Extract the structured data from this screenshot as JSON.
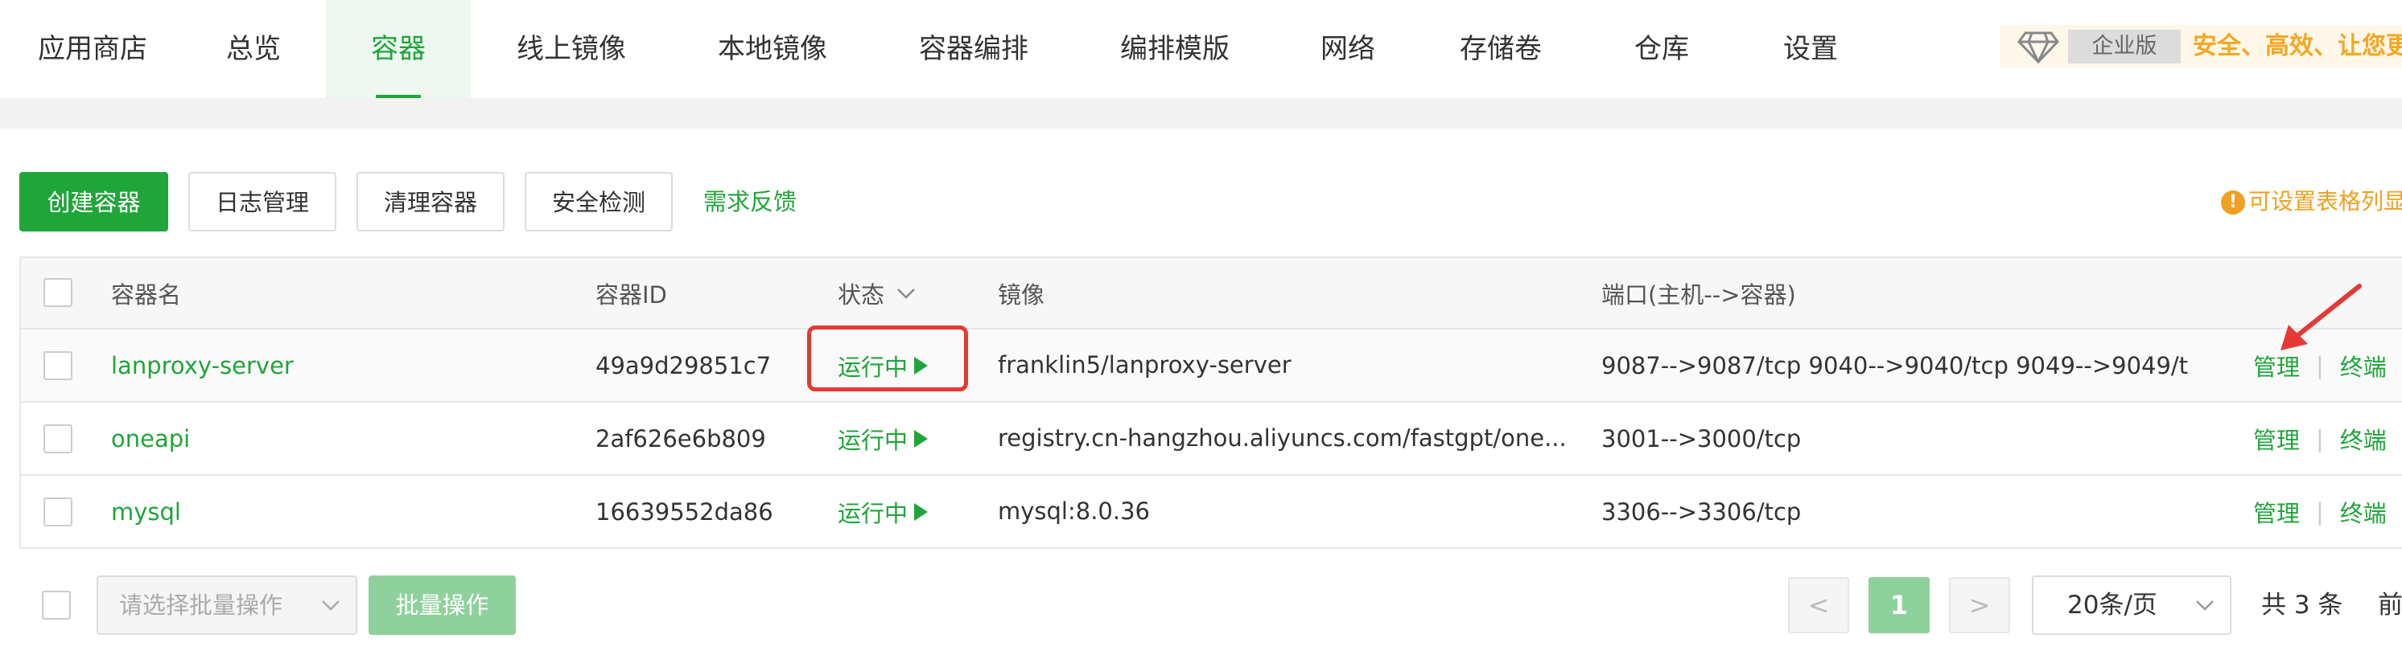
{
  "nav": {
    "tabs": [
      {
        "label": "应用商店"
      },
      {
        "label": "总览"
      },
      {
        "label": "容器",
        "active": true
      },
      {
        "label": "线上镜像"
      },
      {
        "label": "本地镜像"
      },
      {
        "label": "容器编排"
      },
      {
        "label": "编排模版"
      },
      {
        "label": "网络"
      },
      {
        "label": "存储卷"
      },
      {
        "label": "仓库"
      },
      {
        "label": "设置"
      }
    ],
    "promo": {
      "badge": "企业版",
      "text": "安全、高效、让您更安"
    }
  },
  "toolbar": {
    "create": "创建容器",
    "logs": "日志管理",
    "clean": "清理容器",
    "security": "安全检测",
    "feedback": "需求反馈",
    "tip": "可设置表格列显"
  },
  "table": {
    "headers": {
      "name": "容器名",
      "id": "容器ID",
      "status": "状态",
      "image": "镜像",
      "ports": "端口(主机-->容器)"
    },
    "rows": [
      {
        "name": "lanproxy-server",
        "id": "49a9d29851c7",
        "status": "运行中",
        "image": "franklin5/lanproxy-server",
        "ports": "9087-->9087/tcp 9040-->9040/tcp 9049-->9049/t",
        "manage": "管理",
        "terminal": "终端"
      },
      {
        "name": "oneapi",
        "id": "2af626e6b809",
        "status": "运行中",
        "image": "registry.cn-hangzhou.aliyuncs.com/fastgpt/one...",
        "ports": "3001-->3000/tcp",
        "manage": "管理",
        "terminal": "终端"
      },
      {
        "name": "mysql",
        "id": "16639552da86",
        "status": "运行中",
        "image": "mysql:8.0.36",
        "ports": "3306-->3306/tcp",
        "manage": "管理",
        "terminal": "终端"
      }
    ]
  },
  "footer": {
    "batch_placeholder": "请选择批量操作",
    "batch_button": "批量操作",
    "prev": "<",
    "current_page": "1",
    "next": ">",
    "page_size": "20条/页",
    "total": "共 3 条",
    "goto": "前"
  },
  "colors": {
    "accent": "#20a53a",
    "highlight": "#e53935",
    "warning": "#f0a020"
  }
}
